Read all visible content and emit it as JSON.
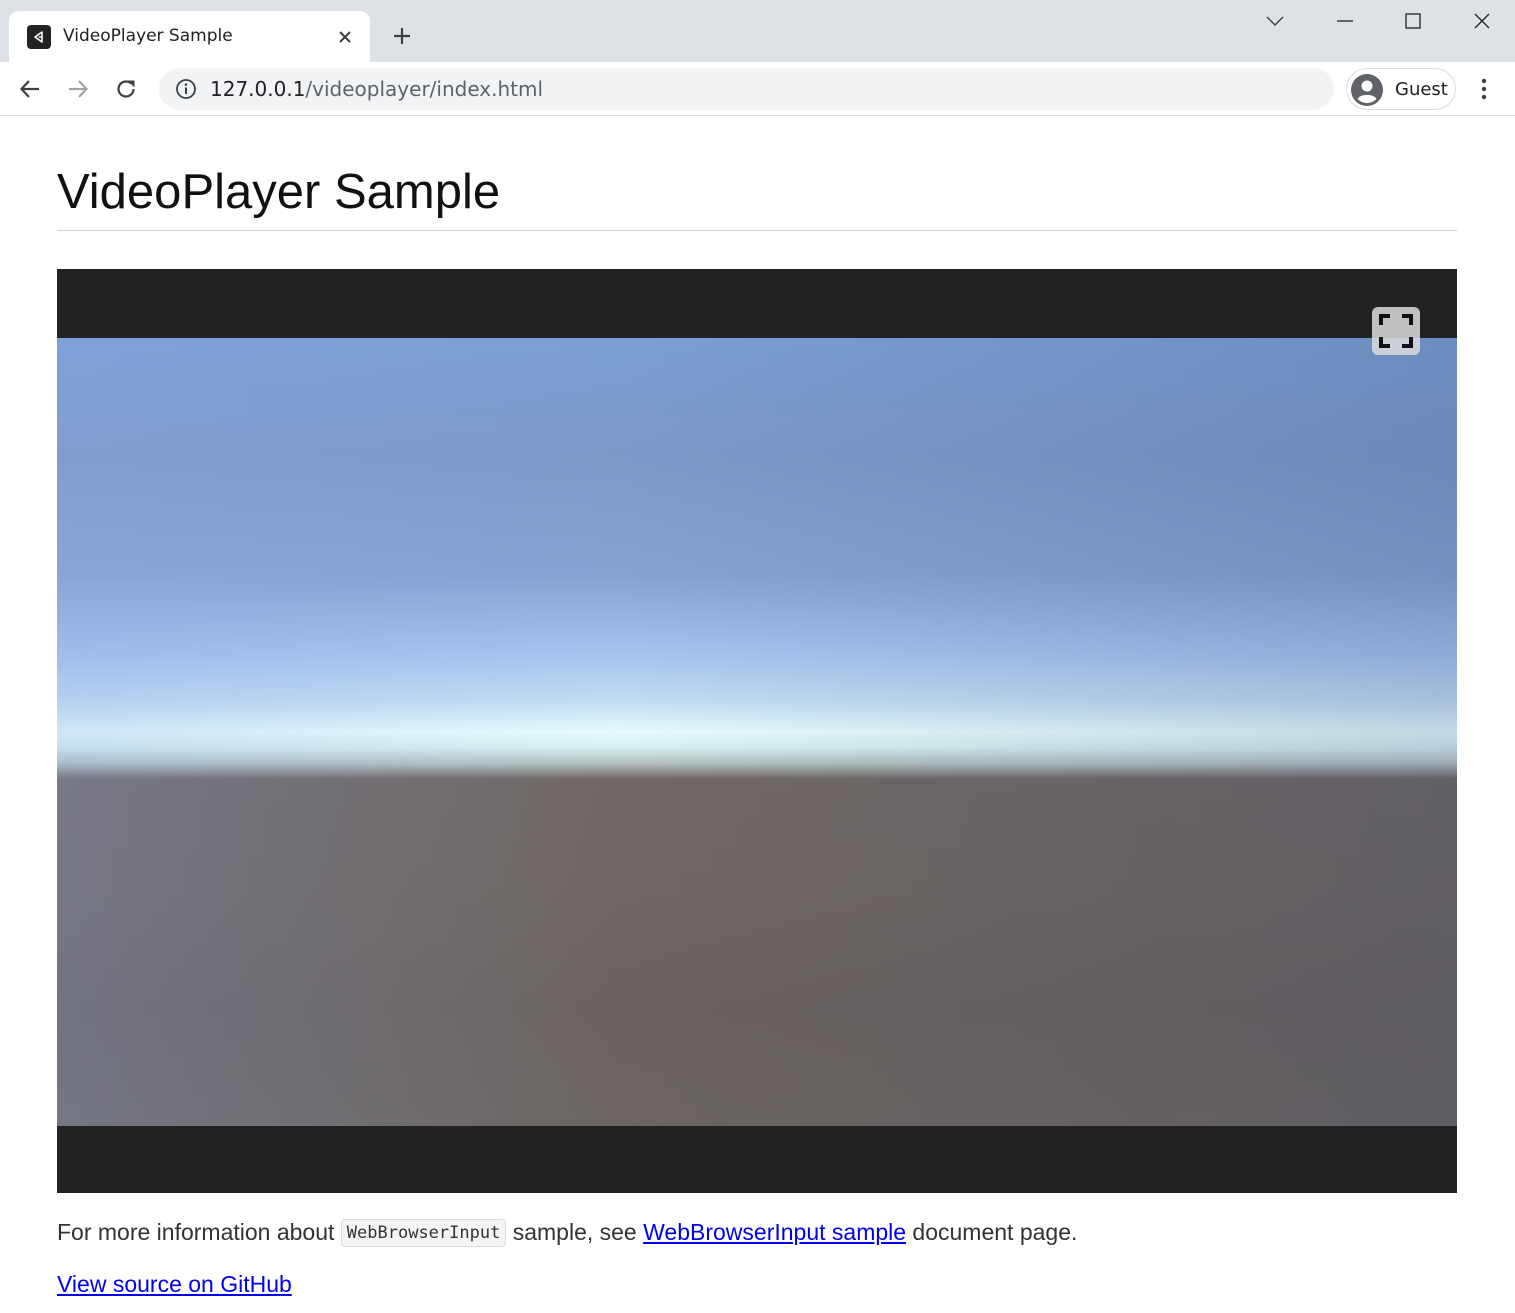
{
  "browser": {
    "tab": {
      "title": "VideoPlayer Sample",
      "favicon": "unity-icon"
    },
    "new_tab_label": "New tab",
    "address": {
      "host": "127.0.0.1",
      "path": "/videoplayer/index.html"
    },
    "profile_label": "Guest"
  },
  "page": {
    "title": "VideoPlayer Sample",
    "info": {
      "prefix": "For more information about ",
      "code": "WebBrowserInput",
      "middle": " sample, see ",
      "link_text": "WebBrowserInput sample",
      "suffix": " document page."
    },
    "github_link_text": "View source on GitHub"
  },
  "colors": {
    "tabstrip": "#dee1e6",
    "player_bg": "#222222",
    "link": "#0000ee"
  }
}
